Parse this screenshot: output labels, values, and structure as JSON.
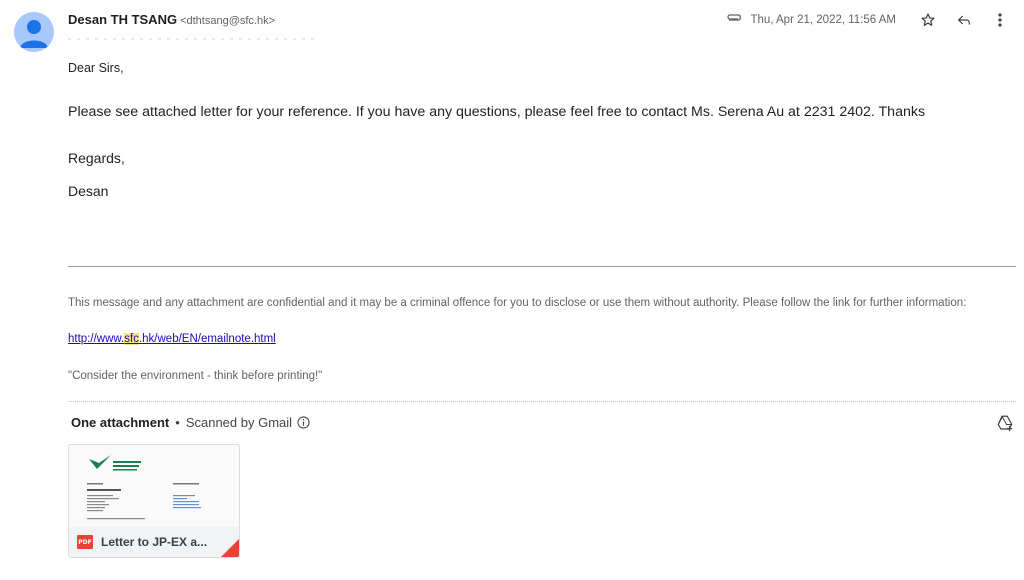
{
  "sender": {
    "name": "Desan TH TSANG",
    "email": "<dthtsang@sfc.hk>"
  },
  "meta": {
    "date": "Thu, Apr 21, 2022, 11:56 AM"
  },
  "icons": {
    "attachment": "paperclip-icon",
    "star": "star-icon",
    "reply": "reply-icon",
    "more": "more-vert-icon",
    "drive": "add-to-drive-icon",
    "info": "info-icon",
    "pdf": "pdf-icon"
  },
  "body": {
    "greeting": "Dear Sirs,",
    "message": "Please see attached letter for your reference.   If you have any questions, please feel free to contact Ms. Serena Au at 2231 2402.  Thanks",
    "regards": "Regards,",
    "signature": "Desan"
  },
  "footer": {
    "disclaimer": "This message and any attachment are confidential and it may be a criminal offence for you to disclose or use them without authority. Please follow the link for further information:",
    "link_prefix": "http://www.",
    "link_highlight": "sfc",
    "link_suffix": ".hk/web/EN/emailnote.html",
    "environment": "\"Consider the environment - think before printing!\""
  },
  "attachments": {
    "title": "One attachment",
    "scanned": "Scanned by Gmail",
    "items": [
      {
        "badge": "PDF",
        "name": "Letter to JP-EX a..."
      }
    ]
  },
  "colors": {
    "avatar_bg": "#a8c7fa",
    "avatar_fg": "#1a73e8",
    "link": "#1a0dab",
    "highlight": "#f9e08a",
    "pdf_red": "#ea4335"
  }
}
